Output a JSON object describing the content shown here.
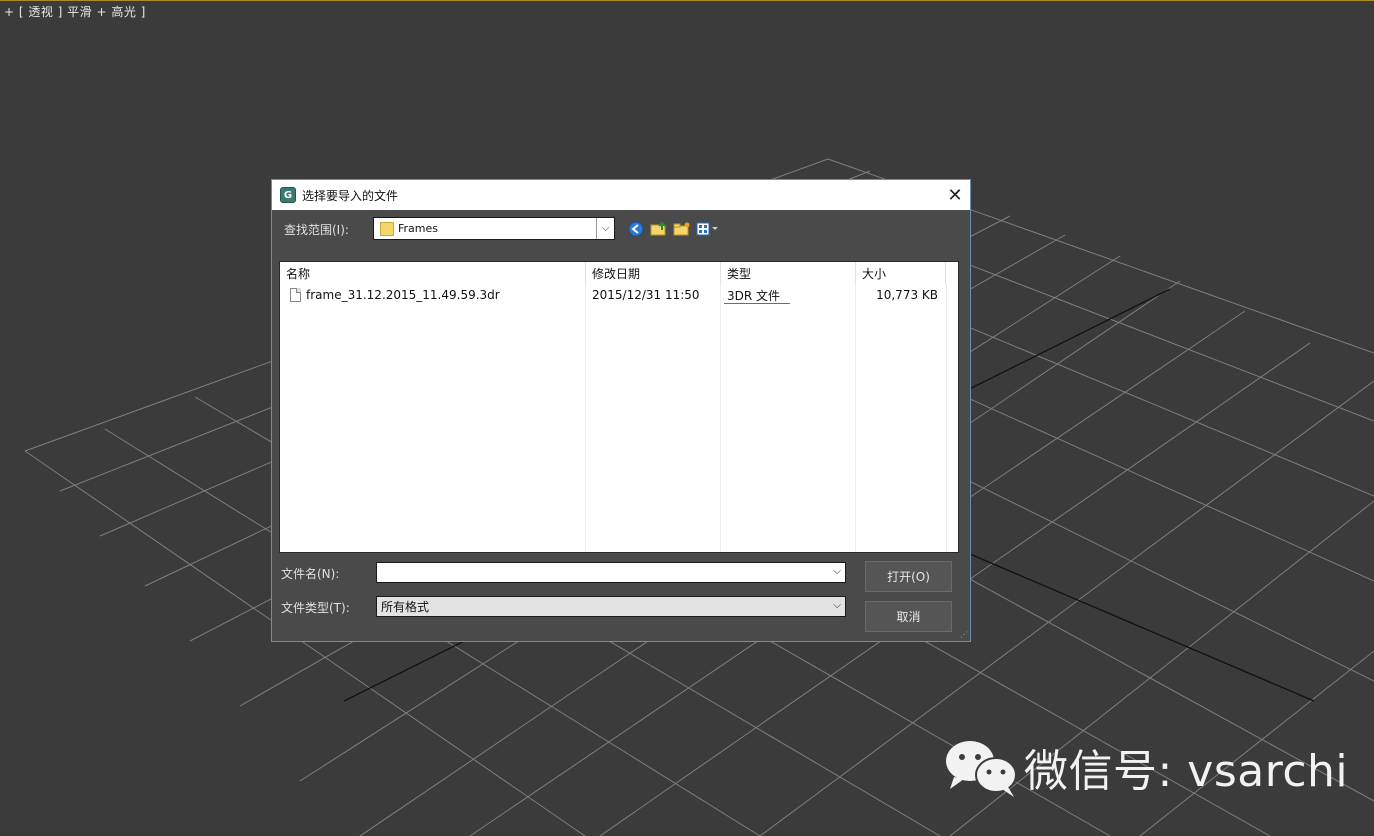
{
  "viewport": {
    "label": "+ [ 透视 ] 平滑 + 高光 ]"
  },
  "dialog": {
    "title": "选择要导入的文件",
    "close_label": "✕",
    "lookin_label": "查找范围(I):",
    "lookin_value": "Frames",
    "columns": {
      "name": "名称",
      "modified": "修改日期",
      "type": "类型",
      "size": "大小"
    },
    "files": [
      {
        "name": "frame_31.12.2015_11.49.59.3dr",
        "modified": "2015/12/31 11:50",
        "type": "3DR 文件",
        "size": "10,773 KB"
      }
    ],
    "filename_label": "文件名(N):",
    "filename_value": "",
    "filetype_label": "文件类型(T):",
    "filetype_value": "所有格式",
    "open_button": "打开(O)",
    "cancel_button": "取消",
    "toolbar_icons": [
      "back-icon",
      "up-folder-icon",
      "new-folder-icon",
      "view-menu-icon"
    ]
  },
  "watermark": {
    "text": "微信号: vsarchi"
  },
  "colors": {
    "viewport_bg": "#3b3b3b",
    "dialog_bg": "#4a4a4a",
    "accent_red": "#e33333",
    "titlebar_bg": "#ffffff"
  }
}
